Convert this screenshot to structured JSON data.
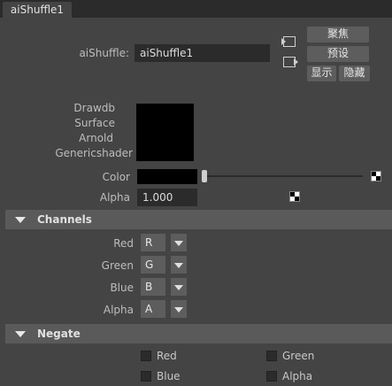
{
  "tab": {
    "label": "aiShuffle1"
  },
  "node": {
    "label": "aiShuffle:",
    "value": "aiShuffle1"
  },
  "buttons": {
    "focus": "聚焦",
    "presets": "预设",
    "show": "显示",
    "hide": "隐藏"
  },
  "swatch_labels": [
    "Drawdb",
    "Surface",
    "Arnold",
    "Genericshader"
  ],
  "color": {
    "label": "Color",
    "value": "#000000"
  },
  "alpha": {
    "label": "Alpha",
    "value": "1.000"
  },
  "channels": {
    "title": "Channels",
    "rows": [
      {
        "label": "Red",
        "value": "R"
      },
      {
        "label": "Green",
        "value": "G"
      },
      {
        "label": "Blue",
        "value": "B"
      },
      {
        "label": "Alpha",
        "value": "A"
      }
    ]
  },
  "negate": {
    "title": "Negate",
    "items": [
      {
        "label": "Red",
        "checked": false
      },
      {
        "label": "Green",
        "checked": false
      },
      {
        "label": "Blue",
        "checked": false
      },
      {
        "label": "Alpha",
        "checked": false
      }
    ]
  }
}
